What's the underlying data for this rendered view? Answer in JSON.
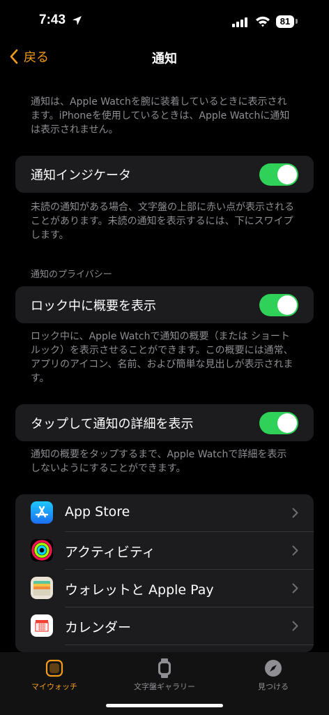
{
  "status_bar": {
    "time": "7:43",
    "battery": "81"
  },
  "nav": {
    "back_label": "戻る",
    "title": "通知"
  },
  "intro_text": "通知は、Apple Watchを腕に装着しているときに表示されます。iPhoneを使用しているときは、Apple Watchに通知は表示されません。",
  "indicator": {
    "label": "通知インジケータ",
    "enabled": true,
    "footnote": "未読の通知がある場合、文字盤の上部に赤い点が表示されることがあります。未読の通知を表示するには、下にスワイプします。"
  },
  "privacy": {
    "header": "通知のプライバシー",
    "summary_label": "ロック中に概要を表示",
    "summary_enabled": true,
    "summary_footnote": "ロック中に、Apple Watchで通知の概要（または ショートルック）を表示させることができます。この概要には通常、アプリのアイコン、名前、および簡単な見出しが表示されます。",
    "tap_label": "タップして通知の詳細を表示",
    "tap_enabled": true,
    "tap_footnote": "通知の概要をタップするまで、Apple Watchで詳細を表示しないようにすることができます。"
  },
  "apps": [
    {
      "name": "App Store",
      "icon": "app-store-icon"
    },
    {
      "name": "アクティビティ",
      "icon": "activity-icon"
    },
    {
      "name": "ウォレットと Apple Pay",
      "icon": "wallet-icon"
    },
    {
      "name": "カレンダー",
      "icon": "calendar-icon"
    }
  ],
  "tabs": [
    {
      "label": "マイウォッチ",
      "icon": "watch-icon",
      "active": true
    },
    {
      "label": "文字盤ギャラリー",
      "icon": "watch-face-gallery-icon",
      "active": false
    },
    {
      "label": "見つける",
      "icon": "compass-icon",
      "active": false
    }
  ],
  "colors": {
    "accent": "#f39c1b",
    "toggle_on": "#30d158",
    "card": "#1c1c1e",
    "secondary_text": "#8e8e93"
  }
}
